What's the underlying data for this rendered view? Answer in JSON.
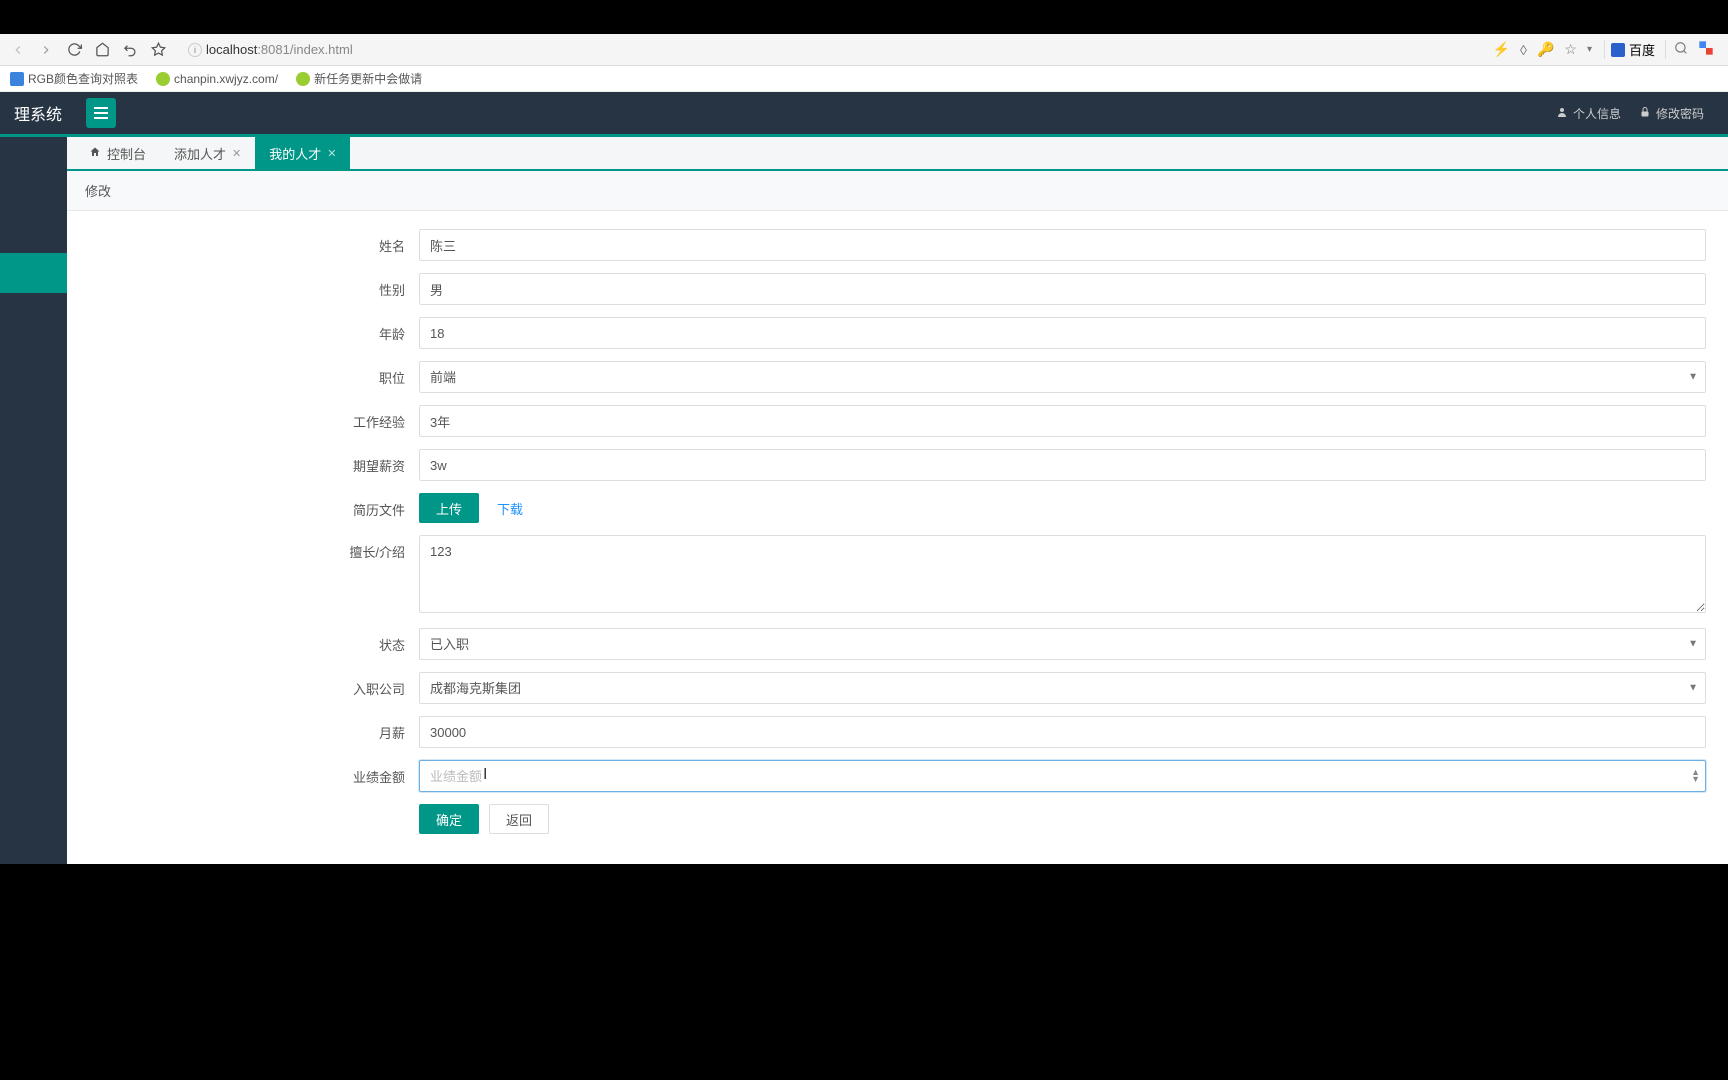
{
  "browser": {
    "url_host": "localhost",
    "url_port": ":8081",
    "url_path": "/index.html",
    "search_engine": "百度",
    "bookmarks": [
      {
        "label": "RGB颜色查询对照表"
      },
      {
        "label": "chanpin.xwjyz.com/"
      },
      {
        "label": "新任务更新中会做请"
      }
    ]
  },
  "header": {
    "app_name": "理系统",
    "right_links": {
      "profile": "个人信息",
      "password": "修改密码"
    }
  },
  "tabs": {
    "console": "控制台",
    "add_talent": "添加人才",
    "my_talent": "我的人才"
  },
  "panel": {
    "title": "修改"
  },
  "form": {
    "name_label": "姓名",
    "name_value": "陈三",
    "gender_label": "性别",
    "gender_value": "男",
    "age_label": "年龄",
    "age_value": "18",
    "position_label": "职位",
    "position_value": "前端",
    "experience_label": "工作经验",
    "experience_value": "3年",
    "salary_expect_label": "期望薪资",
    "salary_expect_value": "3w",
    "resume_label": "简历文件",
    "upload_btn": "上传",
    "download_link": "下载",
    "intro_label": "擅长/介绍",
    "intro_value": "123",
    "status_label": "状态",
    "status_value": "已入职",
    "company_label": "入职公司",
    "company_value": "成都海克斯集团",
    "monthly_salary_label": "月薪",
    "monthly_salary_value": "30000",
    "performance_label": "业绩金额",
    "performance_placeholder": "业绩金额",
    "submit_btn": "确定",
    "back_btn": "返回"
  }
}
